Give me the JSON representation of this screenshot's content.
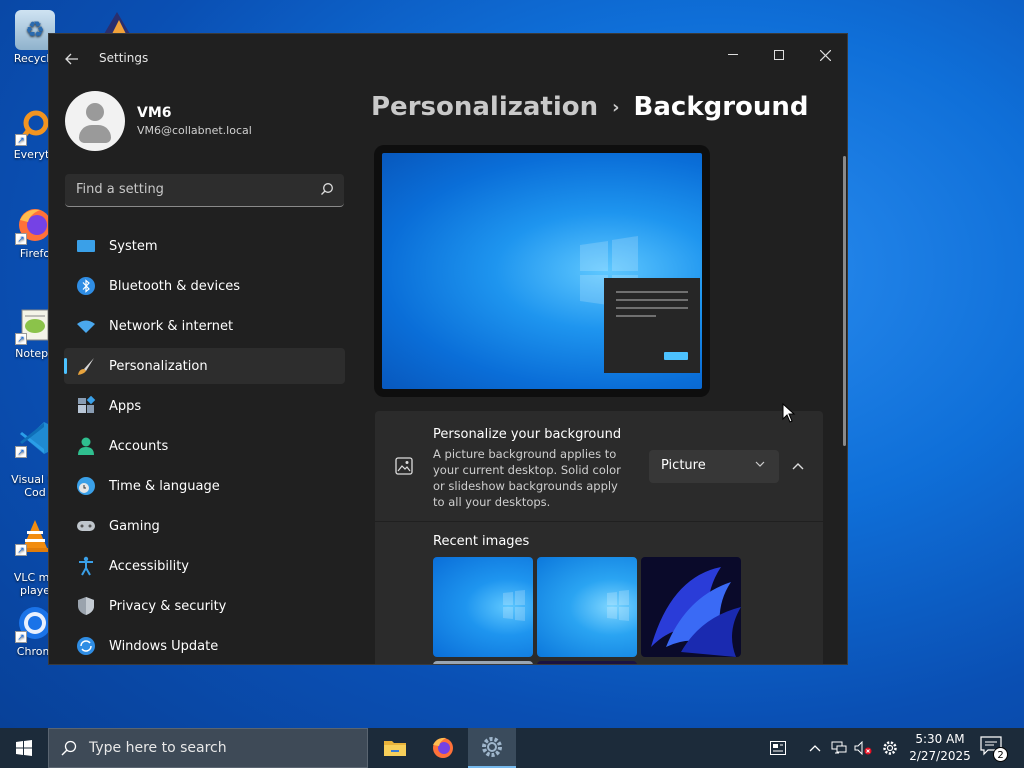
{
  "desktop": {
    "icons": [
      {
        "label": "Recycle",
        "icon": "recycle-bin-icon"
      },
      {
        "label": "Everyth",
        "icon": "everything-search-icon"
      },
      {
        "label": "Firefo",
        "icon": "firefox-icon"
      },
      {
        "label": "Notepa",
        "icon": "notepad-plus-plus-icon"
      },
      {
        "label": "Visual St\nCod",
        "icon": "visual-studio-code-icon"
      },
      {
        "label": "VLC me\nplaye",
        "icon": "vlc-icon"
      },
      {
        "label": "Chrom",
        "icon": "chrome-icon"
      }
    ]
  },
  "window": {
    "title": "Settings",
    "controls": {
      "minimize": "—",
      "maximize": "☐",
      "close": "✕"
    }
  },
  "profile": {
    "name": "VM6",
    "email": "VM6@collabnet.local"
  },
  "search": {
    "placeholder": "Find a setting"
  },
  "nav": {
    "items": [
      {
        "label": "System",
        "icon": "system-icon",
        "active": false
      },
      {
        "label": "Bluetooth & devices",
        "icon": "bluetooth-icon",
        "active": false
      },
      {
        "label": "Network & internet",
        "icon": "wifi-icon",
        "active": false
      },
      {
        "label": "Personalization",
        "icon": "brush-icon",
        "active": true
      },
      {
        "label": "Apps",
        "icon": "apps-icon",
        "active": false
      },
      {
        "label": "Accounts",
        "icon": "accounts-icon",
        "active": false
      },
      {
        "label": "Time & language",
        "icon": "globe-clock-icon",
        "active": false
      },
      {
        "label": "Gaming",
        "icon": "gamepad-icon",
        "active": false
      },
      {
        "label": "Accessibility",
        "icon": "accessibility-icon",
        "active": false
      },
      {
        "label": "Privacy & security",
        "icon": "shield-icon",
        "active": false
      },
      {
        "label": "Windows Update",
        "icon": "update-icon",
        "active": false
      }
    ]
  },
  "main": {
    "breadcrumb_parent": "Personalization",
    "breadcrumb_sep": "›",
    "breadcrumb_current": "Background",
    "personalize": {
      "title": "Personalize your background",
      "description": "A picture background applies to your current desktop. Solid color or slideshow backgrounds apply to all your desktops.",
      "dropdown_value": "Picture"
    },
    "recent_images_label": "Recent images"
  },
  "taskbar": {
    "search_placeholder": "Type here to search",
    "time": "5:30 AM",
    "date": "2/27/2025",
    "notification_count": "2"
  },
  "colors": {
    "accent": "#4cc2ff",
    "window_bg": "#202020",
    "card_bg": "#2b2b2b",
    "taskbar_bg": "#1c2b3a"
  }
}
